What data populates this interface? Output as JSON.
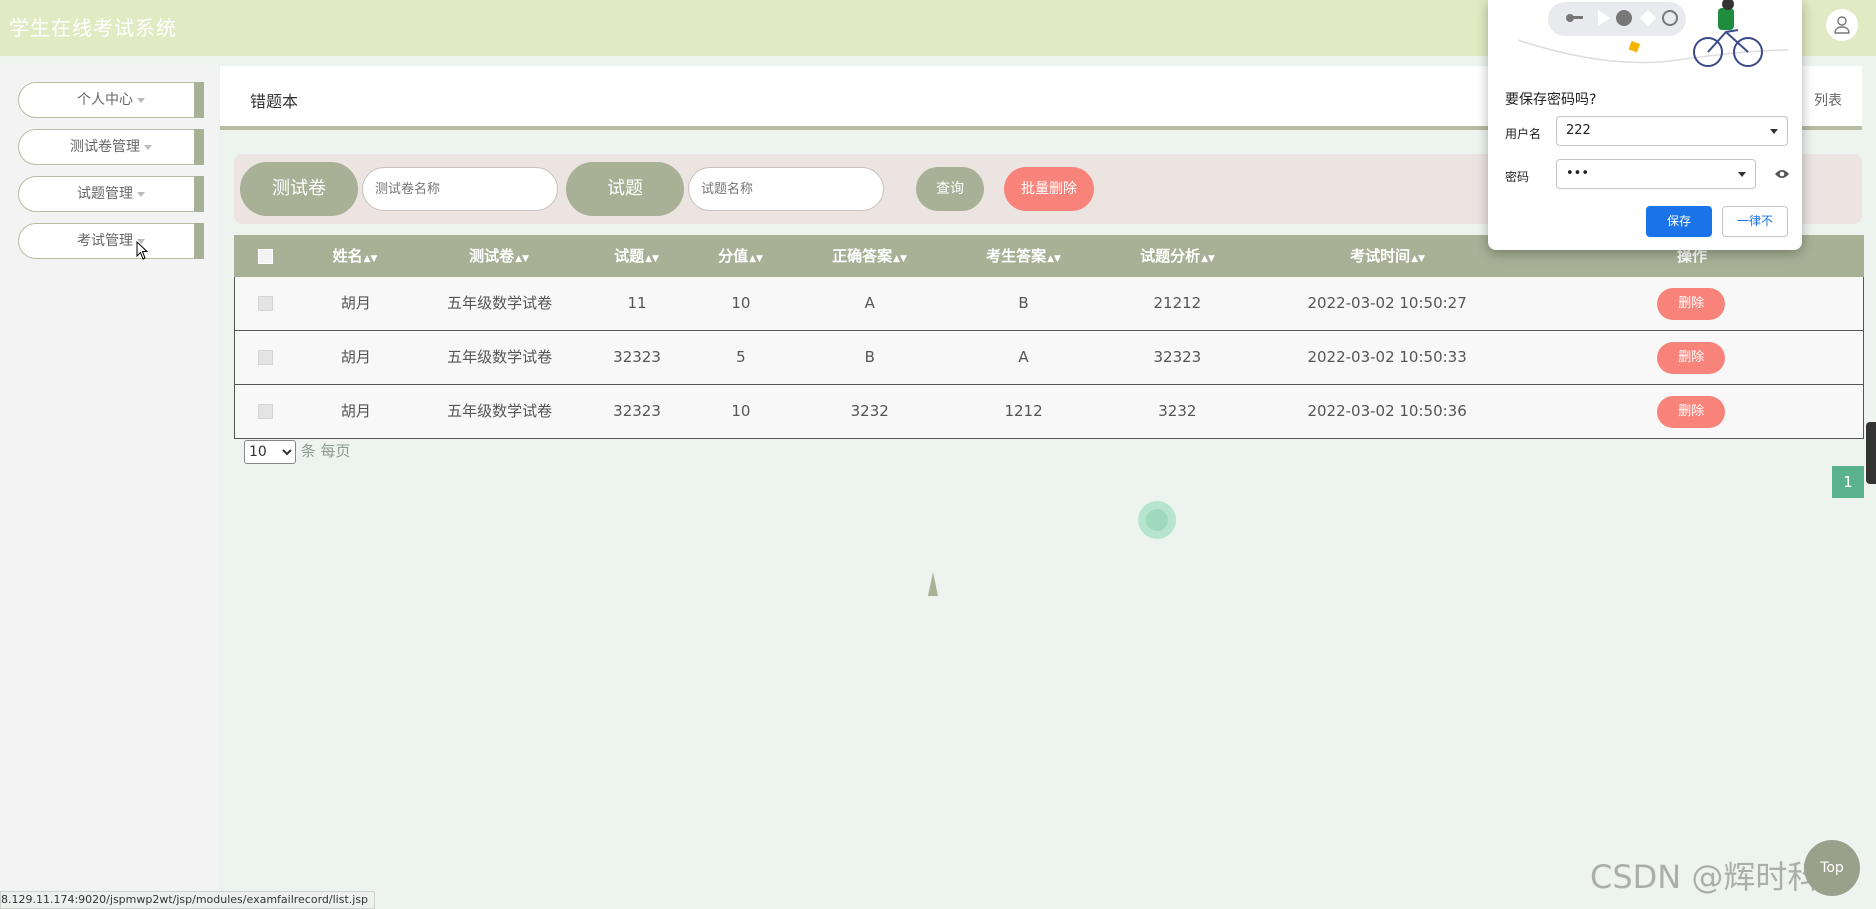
{
  "header": {
    "app_title": "学生在线考试系统"
  },
  "sidebar": {
    "items": [
      {
        "label": "个人中心"
      },
      {
        "label": "测试卷管理"
      },
      {
        "label": "试题管理"
      },
      {
        "label": "考试管理"
      }
    ]
  },
  "breadcrumb": {
    "title": "错题本",
    "right_text": "列表"
  },
  "search": {
    "paper_label": "测试卷",
    "paper_placeholder": "测试卷名称",
    "question_label": "试题",
    "question_placeholder": "试题名称",
    "query_button": "查询",
    "batch_delete_button": "批量删除"
  },
  "table": {
    "columns": [
      "姓名",
      "测试卷",
      "试题",
      "分值",
      "正确答案",
      "考生答案",
      "试题分析",
      "考试时间",
      "操作"
    ],
    "delete_label": "删除",
    "rows": [
      {
        "name": "胡月",
        "paper": "五年级数学试卷",
        "question": "11",
        "score": "10",
        "correct": "A",
        "answer": "B",
        "analysis": "21212",
        "time": "2022-03-02 10:50:27"
      },
      {
        "name": "胡月",
        "paper": "五年级数学试卷",
        "question": "32323",
        "score": "5",
        "correct": "B",
        "answer": "A",
        "analysis": "32323",
        "time": "2022-03-02 10:50:33"
      },
      {
        "name": "胡月",
        "paper": "五年级数学试卷",
        "question": "32323",
        "score": "10",
        "correct": "3232",
        "answer": "1212",
        "analysis": "3232",
        "time": "2022-03-02 10:50:36"
      }
    ]
  },
  "pagination": {
    "page_size": "10",
    "per_page_label": "条 每页",
    "current_page": "1"
  },
  "password_popup": {
    "question": "要保存密码吗?",
    "username_label": "用户名",
    "username_value": "222",
    "password_label": "密码",
    "password_value": "•••",
    "save_button": "保存",
    "never_button": "一律不"
  },
  "status_url": "8.129.11.174:9020/jspmwp2wt/jsp/modules/examfailrecord/list.jsp",
  "watermark": "CSDN @辉时科技",
  "top_button": "Top",
  "colors": {
    "accent": "#a8b096",
    "danger": "#f7837a",
    "topbar": "#e1eac3",
    "page_active": "#5ab28d"
  }
}
